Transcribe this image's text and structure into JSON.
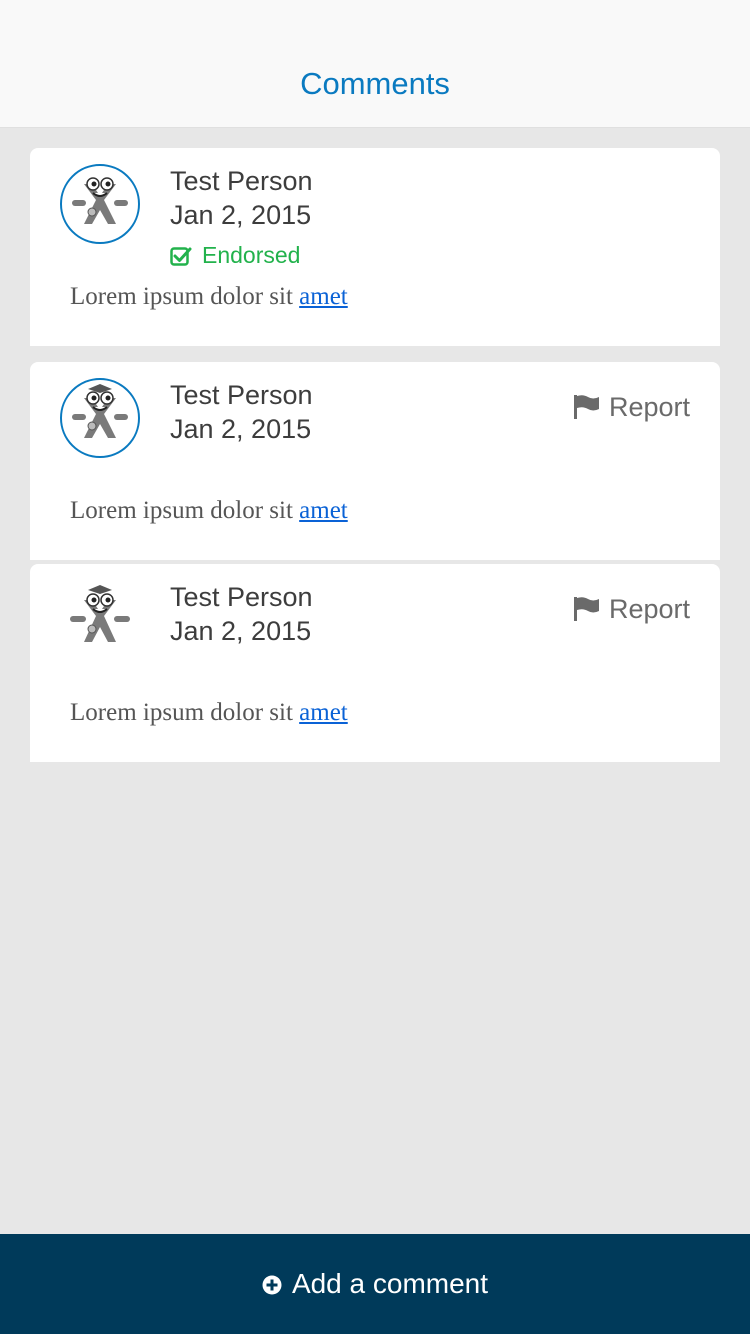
{
  "navbar": {
    "title": "Comments"
  },
  "comments": [
    {
      "author": "Test Person",
      "date": "Jan 2, 2015",
      "endorsed_label": "Endorsed",
      "body_text": "Lorem ipsum dolor sit ",
      "body_link": "amet",
      "avatar_icon": "mascot-avatar-icon"
    },
    {
      "author": "Test Person",
      "date": "Jan 2, 2015",
      "report_label": "Report",
      "body_text": "Lorem ipsum dolor sit ",
      "body_link": "amet",
      "avatar_icon": "mascot-avatar-icon"
    },
    {
      "author": "Test Person",
      "date": "Jan 2, 2015",
      "report_label": "Report",
      "body_text": "Lorem ipsum dolor sit ",
      "body_link": "amet",
      "avatar_icon": "mascot-avatar-icon"
    }
  ],
  "footer": {
    "add_comment_label": "Add a comment",
    "add_icon": "plus-circle-icon"
  },
  "colors": {
    "accent": "#0a7ac0",
    "endorsed": "#22b24c",
    "footer_bg": "#003a5a",
    "link": "#0a62d6"
  }
}
